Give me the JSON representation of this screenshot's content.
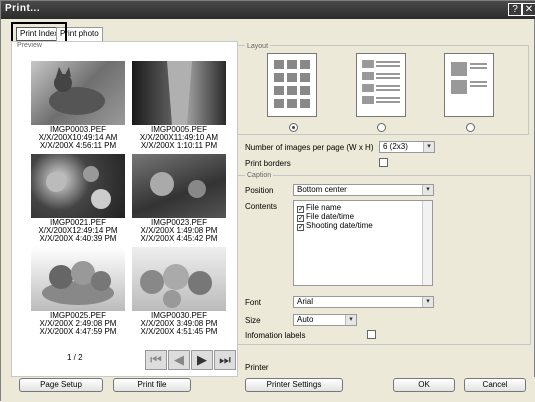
{
  "window": {
    "title": "Print..."
  },
  "tabs": [
    "Print Index",
    "Print photo"
  ],
  "preview": {
    "group_label": "Preview",
    "items": [
      {
        "name": "IMGP0003.PEF",
        "t1": "X/X/200X10:49:14 AM",
        "t2": "X/X/200X 4:56:11 PM"
      },
      {
        "name": "IMGP0005.PEF",
        "t1": "X/X/200X11:49:10 AM",
        "t2": "X/X/200X 1:10:11 PM"
      },
      {
        "name": "IMGP0021.PEF",
        "t1": "X/X/200X12:49:14 PM",
        "t2": "X/X/200X 4:40:39 PM"
      },
      {
        "name": "IMGP0023.PEF",
        "t1": "X/X/200X 1:49:08 PM",
        "t2": "X/X/200X 4:45:42 PM"
      },
      {
        "name": "IMGP0025.PEF",
        "t1": "X/X/200X 2:49:08 PM",
        "t2": "X/X/200X 4:47:59 PM"
      },
      {
        "name": "IMGP0030.PEF",
        "t1": "X/X/200X 3:49:08 PM",
        "t2": "X/X/200X 4:51:45 PM"
      }
    ],
    "page_indicator": "1 / 2"
  },
  "layout": {
    "group_label": "Layout",
    "selected_index": 0
  },
  "settings": {
    "images_per_page_label": "Number of images per page (W x H)",
    "images_per_page_value": "6 (2x3)",
    "print_borders_label": "Print borders",
    "caption_group_label": "Caption",
    "position_label": "Position",
    "position_value": "Bottom center",
    "contents_label": "Contents",
    "contents_items": [
      "File name",
      "File date/time",
      "Shooting date/time"
    ],
    "font_label": "Font",
    "font_value": "Arial",
    "size_label": "Size",
    "size_value": "Auto",
    "info_labels_label": "Infomation labels"
  },
  "printer": {
    "label": "Printer"
  },
  "buttons": {
    "page_setup": "Page Setup",
    "print_file": "Print file",
    "printer_settings": "Printer Settings",
    "ok": "OK",
    "cancel": "Cancel"
  }
}
